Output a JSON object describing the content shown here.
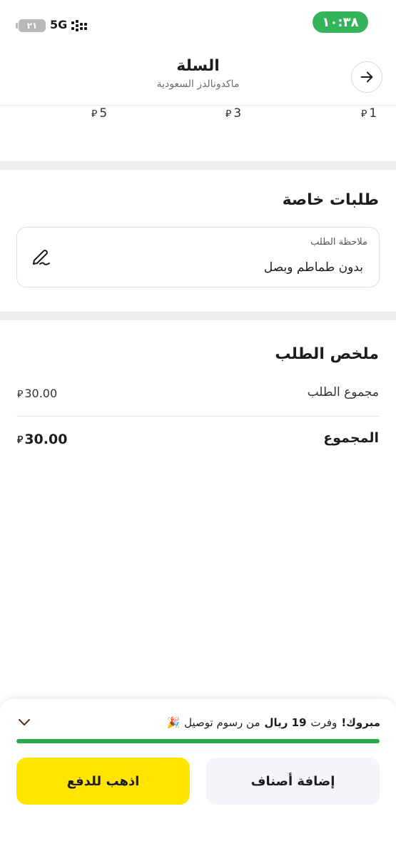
{
  "status_bar": {
    "time": "١٠:٣٨",
    "network": "5G",
    "battery": "٢١",
    "signal_icon": "signal-bars-icon",
    "battery_icon": "battery-charging-icon"
  },
  "header": {
    "title": "السلة",
    "subtitle": "ماكدونالدز السعودية",
    "back_icon": "arrow-right-icon"
  },
  "price_options": [
    {
      "value": "1",
      "currency_symbol": "⃁"
    },
    {
      "value": "3",
      "currency_symbol": "⃁"
    },
    {
      "value": "5",
      "currency_symbol": "⃁"
    }
  ],
  "special_requests": {
    "title": "طلبات خاصة",
    "note_label": "ملاحظة الطلب",
    "note_value": "بدون طماطم وبصل",
    "edit_icon": "pen-icon"
  },
  "order_summary": {
    "title": "ملخص الطلب",
    "subtotal_label": "مجموع الطلب",
    "subtotal_value": "30.00",
    "total_label": "المجموع",
    "total_value": "30.00",
    "currency_symbol": "⃁"
  },
  "promo": {
    "prefix_bold": "مبروك!",
    "text_1": "وفرت",
    "amount_bold": "19 ريال",
    "text_2": "من رسوم توصيل",
    "emoji": "🎉",
    "progress_fraction": 1.0,
    "expand_icon": "chevron-down-icon"
  },
  "buttons": {
    "add_items": "إضافة أصناف",
    "checkout": "اذهب للدفع"
  },
  "colors": {
    "accent_green": "#34b35a",
    "progress_green": "#27a84a",
    "checkout_yellow": "#ffe500"
  }
}
